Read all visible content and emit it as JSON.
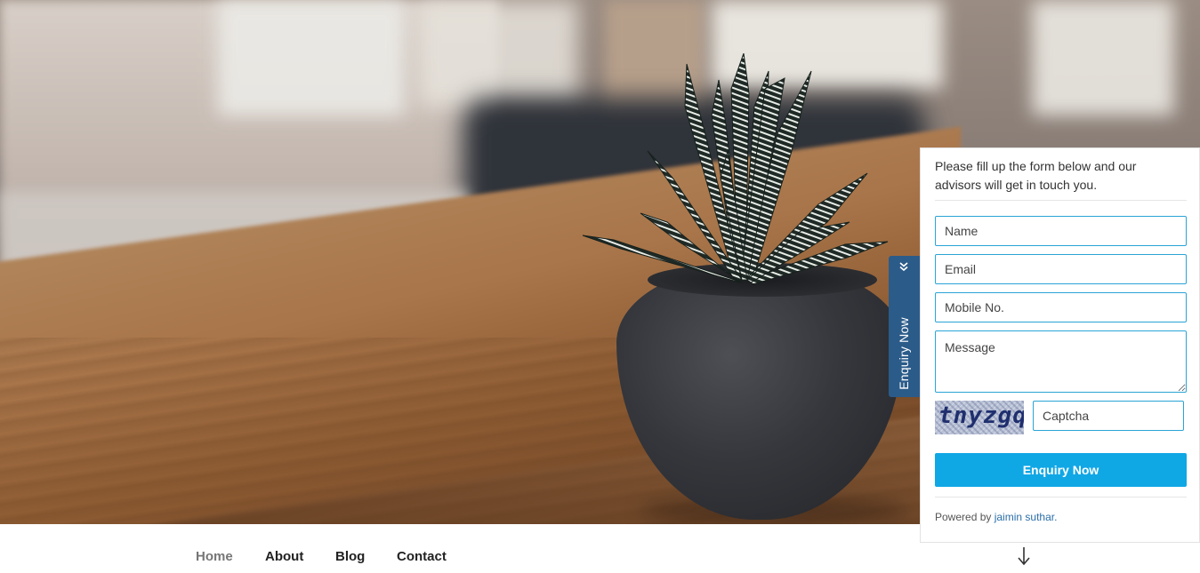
{
  "nav": {
    "items": [
      {
        "label": "Home",
        "active": true
      },
      {
        "label": "About",
        "active": false
      },
      {
        "label": "Blog",
        "active": false
      },
      {
        "label": "Contact",
        "active": false
      }
    ],
    "scroll_icon": "arrow-down-icon"
  },
  "enquiry": {
    "tab_label": "Enquiry Now",
    "tab_icon": "double-chevron-down-icon",
    "intro": "Please fill up the form below and our advisors will get in touch you.",
    "fields": {
      "name_placeholder": "Name",
      "email_placeholder": "Email",
      "mobile_placeholder": "Mobile No.",
      "message_placeholder": "Message",
      "captcha_placeholder": "Captcha"
    },
    "captcha_text": "tnyzgq",
    "submit_label": "Enquiry Now",
    "powered_prefix": "Powered by",
    "powered_link": "jaimin suthar.",
    "colors": {
      "tab": "#2b5b89",
      "button": "#10a7e5",
      "field_border": "#2aa4d6"
    }
  }
}
